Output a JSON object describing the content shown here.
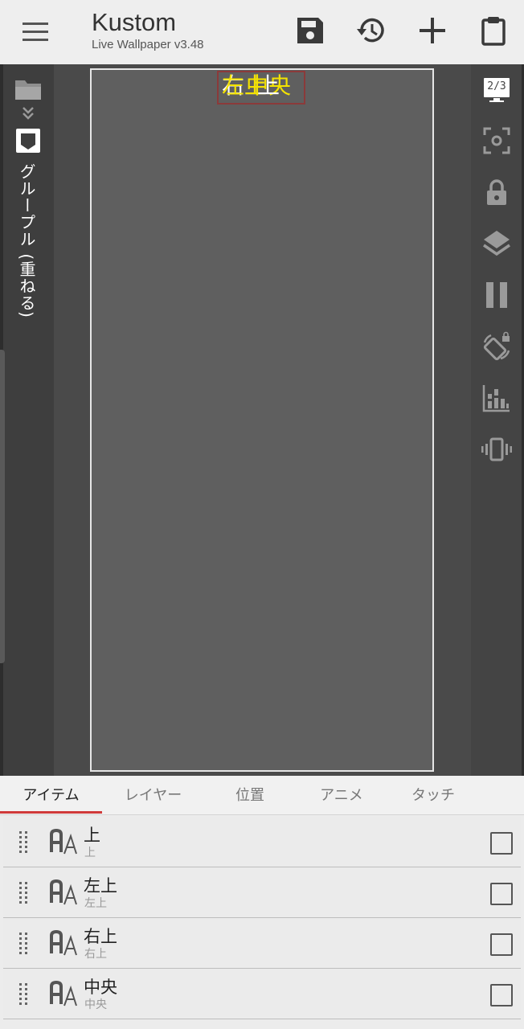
{
  "app": {
    "title": "Kustom",
    "subtitle": "Live Wallpaper v3.48"
  },
  "toolbar_icons": [
    "menu-icon",
    "save-icon",
    "history-icon",
    "add-icon",
    "clipboard-icon"
  ],
  "sidebar": {
    "group_label": "グループル (重ねる)",
    "icons": [
      "folder-icon",
      "double-chevron-down-icon",
      "group-item-icon"
    ]
  },
  "preview": {
    "overlap_texts": [
      "右上",
      "左上",
      "中央",
      "上"
    ],
    "colors": {
      "yellow": "#f4e300",
      "white": "#ffffff",
      "selection": "#8b3a3a"
    }
  },
  "right_toolbar": {
    "page_indicator": "2/3",
    "icons": [
      "preview-page-icon",
      "focus-icon",
      "lock-icon",
      "layers-icon",
      "pause-icon",
      "rotate-lock-icon",
      "bar-chart-icon",
      "vibrate-icon"
    ]
  },
  "tabs": [
    {
      "label": "アイテム",
      "active": true
    },
    {
      "label": "レイヤー",
      "active": false
    },
    {
      "label": "位置",
      "active": false
    },
    {
      "label": "アニメ",
      "active": false
    },
    {
      "label": "タッチ",
      "active": false
    }
  ],
  "items": [
    {
      "title": "上",
      "subtitle": "上",
      "checked": false
    },
    {
      "title": "左上",
      "subtitle": "左上",
      "checked": false
    },
    {
      "title": "右上",
      "subtitle": "右上",
      "checked": false
    },
    {
      "title": "中央",
      "subtitle": "中央",
      "checked": false
    }
  ],
  "accent_color": "#d03a3a"
}
